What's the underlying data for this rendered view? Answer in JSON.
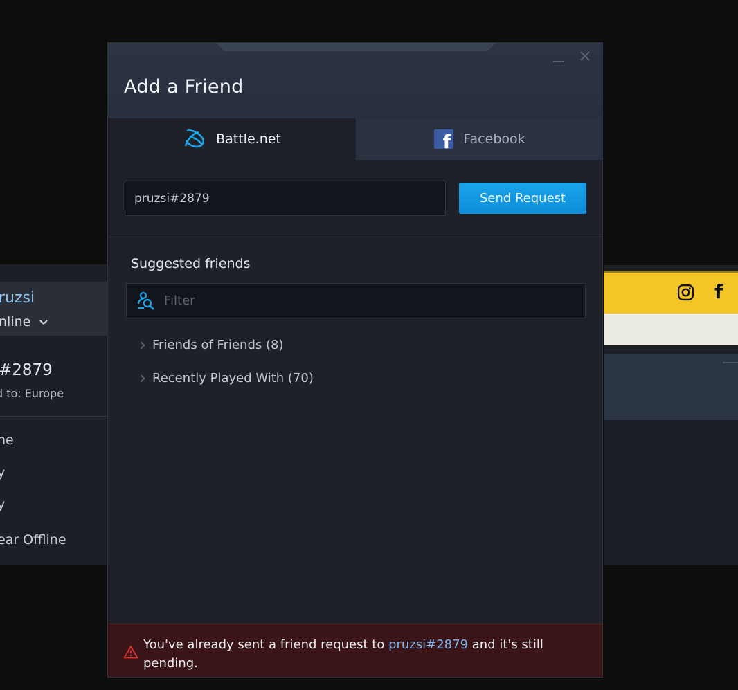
{
  "background_left": {
    "name_partial": "ruzsi",
    "status_partial": "nline",
    "battletag_partial": "#2879",
    "region_partial": "d to: Europe",
    "status_options": [
      "ne",
      "y",
      "y",
      "ear Offline"
    ]
  },
  "dialog": {
    "title": "Add a Friend",
    "tabs": [
      {
        "label": "Battle.net",
        "icon": "battlenet-icon",
        "active": true
      },
      {
        "label": "Facebook",
        "icon": "facebook-icon",
        "active": false
      }
    ],
    "friend_input_value": "pruzsi#2879",
    "send_button": "Send Request",
    "suggested_title": "Suggested friends",
    "filter_placeholder": "Filter",
    "groups": [
      {
        "label": "Friends of Friends (8)"
      },
      {
        "label": "Recently Played With (70)"
      }
    ],
    "error": {
      "before": "You've already sent a friend request to ",
      "link": "pruzsi#2879",
      "after": " and it's still pending."
    }
  },
  "colors": {
    "accent_blue": "#1aa4ec",
    "link_blue": "#7fb7ee",
    "error_bg": "#3a1416",
    "warning_red": "#e2302f",
    "facebook_blue": "#3b5ba5",
    "banner_yellow": "#f4c527"
  }
}
